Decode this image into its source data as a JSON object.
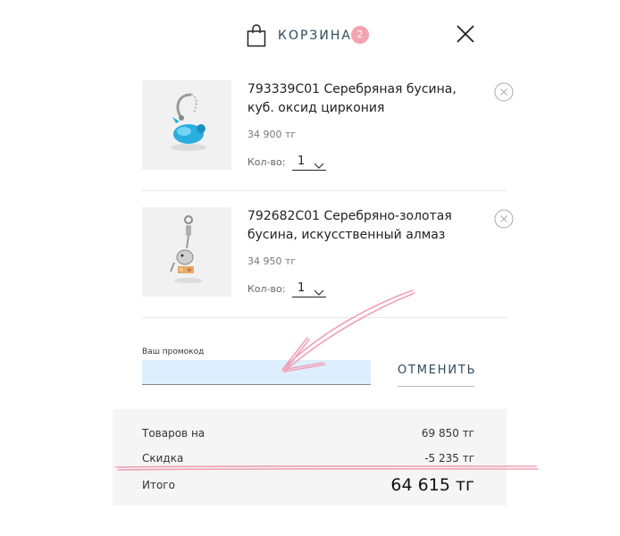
{
  "header": {
    "title": "КОРЗИНА",
    "count": "2"
  },
  "items": [
    {
      "title": "793339C01 Серебряная бусина, куб. оксид циркония",
      "price": "34 900 тг",
      "qty_label": "Кол-во:",
      "qty_value": "1"
    },
    {
      "title": "792682C01 Серебряно-золотая бусина, искусственный алмаз",
      "price": "34 950 тг",
      "qty_label": "Кол-во:",
      "qty_value": "1"
    }
  ],
  "promo": {
    "label": "Ваш промокод",
    "value": "",
    "cancel_label": "ОТМЕНИТЬ"
  },
  "summary": {
    "goods_label": "Товаров на",
    "goods_value": "69 850 тг",
    "discount_label": "Скидка",
    "discount_value": "-5 235 тг",
    "total_label": "Итого",
    "total_value": "64 615 тг"
  },
  "colors": {
    "accent": "#2e4a5a",
    "badge": "#f4a4b0",
    "promo_field": "#ddefff",
    "annotation": "#f2a0b4"
  }
}
